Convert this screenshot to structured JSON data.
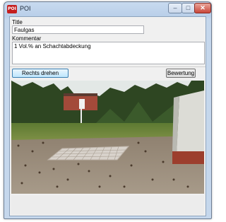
{
  "window": {
    "title": "POI",
    "icon_text": "POI",
    "minimize": "–",
    "maximize": "□",
    "close": "✕"
  },
  "form": {
    "title_label": "Title",
    "title_value": "Faulgas",
    "comment_label": "Kommentar",
    "comment_value": "1 Vol.% an Schachtabdeckung"
  },
  "buttons": {
    "rotate": "Rechts drehen",
    "rating": "Bewertung"
  },
  "colors": {
    "sky": "#dfe6e6",
    "trees": "#2f4a23",
    "grass": "#6f8a3c",
    "pavement": "#9a8c7c",
    "building": "#d8d8d2",
    "manhole": "#cfc8c0"
  }
}
